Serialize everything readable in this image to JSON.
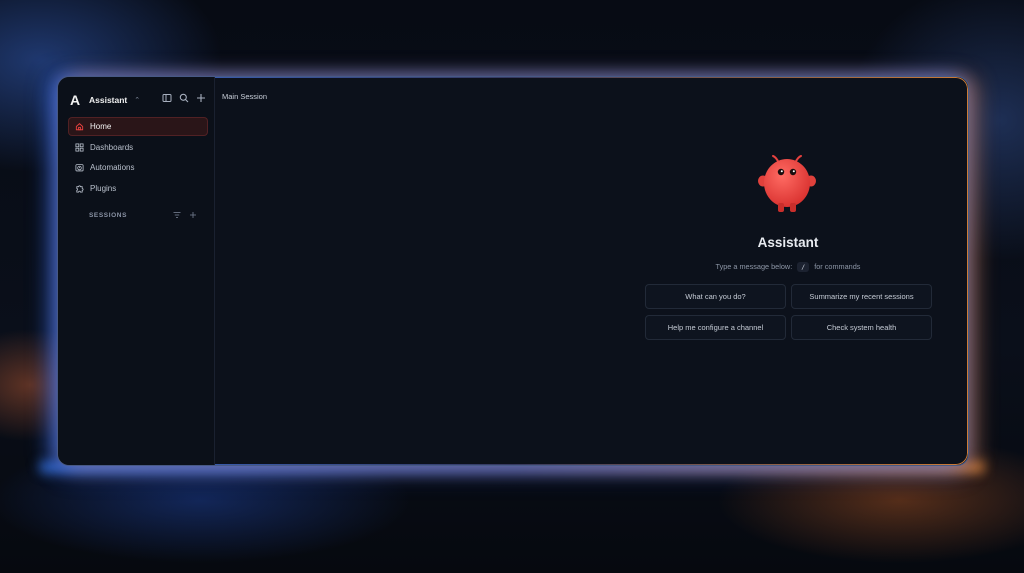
{
  "app": {
    "name": "Assistant",
    "brand_letter": "A"
  },
  "sidebar": {
    "items": [
      {
        "label": "Home",
        "icon": "home-icon",
        "active": true
      },
      {
        "label": "Dashboards",
        "icon": "grid-icon",
        "active": false
      },
      {
        "label": "Automations",
        "icon": "clock-calendar-icon",
        "active": false
      },
      {
        "label": "Plugins",
        "icon": "puzzle-icon",
        "active": false
      }
    ],
    "sessions_label": "SESSIONS"
  },
  "main": {
    "breadcrumb": "Main Session",
    "hero_title": "Assistant",
    "hint_prefix": "Type a message below",
    "hint_key": "/",
    "hint_suffix": "for commands",
    "suggestions": [
      "What can you do?",
      "Summarize my recent sessions",
      "Help me configure a channel",
      "Check system health"
    ]
  },
  "colors": {
    "accent": "#e8413f",
    "active_bg": "#2a1518",
    "window_bg": "#0c111b"
  }
}
